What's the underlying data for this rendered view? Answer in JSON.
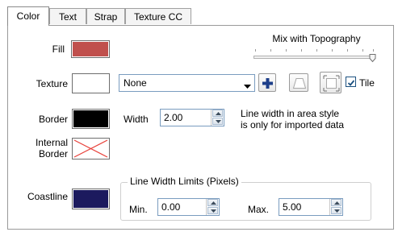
{
  "tabs": [
    "Color",
    "Text",
    "Strap",
    "Texture CC"
  ],
  "active_tab": "Color",
  "fill": {
    "label": "Fill",
    "color": "#c0504d"
  },
  "mix_with_topography": {
    "label": "Mix with Topography",
    "value": 1.0
  },
  "texture": {
    "label": "Texture",
    "selected": "None",
    "tile_label": "Tile",
    "tile_checked": true
  },
  "border": {
    "label": "Border",
    "color": "#000000",
    "width_label": "Width",
    "width_value": "2.00",
    "note_line1": "Line width in area style",
    "note_line2": "is only for imported data"
  },
  "internal_border": {
    "label_line1": "Internal",
    "label_line2": "Border"
  },
  "coastline": {
    "label": "Coastline",
    "color": "#1c1a5e"
  },
  "line_width_limits": {
    "title": "Line Width Limits (Pixels)",
    "min_label": "Min.",
    "min_value": "0.00",
    "max_label": "Max.",
    "max_value": "5.00"
  }
}
